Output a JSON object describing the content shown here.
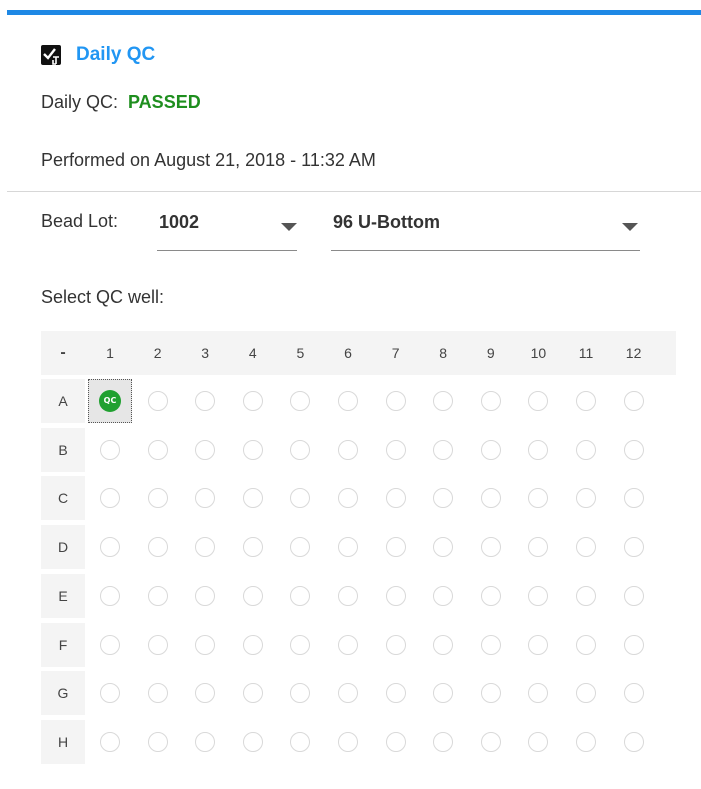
{
  "header": {
    "title": "Daily QC",
    "icon": "qc-checklist-icon"
  },
  "status": {
    "label": "Daily QC:",
    "value": "PASSED",
    "value_color": "#1e8e1e"
  },
  "performed": "Performed on August 21, 2018 - 11:32 AM",
  "bead_lot": {
    "label": "Bead Lot:",
    "value": "1002"
  },
  "plate": {
    "value": "96 U-Bottom"
  },
  "select_prompt": "Select QC well:",
  "plate_grid": {
    "corner": "-",
    "columns": [
      "1",
      "2",
      "3",
      "4",
      "5",
      "6",
      "7",
      "8",
      "9",
      "10",
      "11",
      "12"
    ],
    "rows": [
      "A",
      "B",
      "C",
      "D",
      "E",
      "F",
      "G",
      "H"
    ],
    "qc_well": {
      "row": "A",
      "column": "1",
      "badge": "QC"
    }
  },
  "colors": {
    "accent": "#1e88e5",
    "title": "#2196f3",
    "passed": "#1e8e1e",
    "qc_badge": "#20a030"
  }
}
